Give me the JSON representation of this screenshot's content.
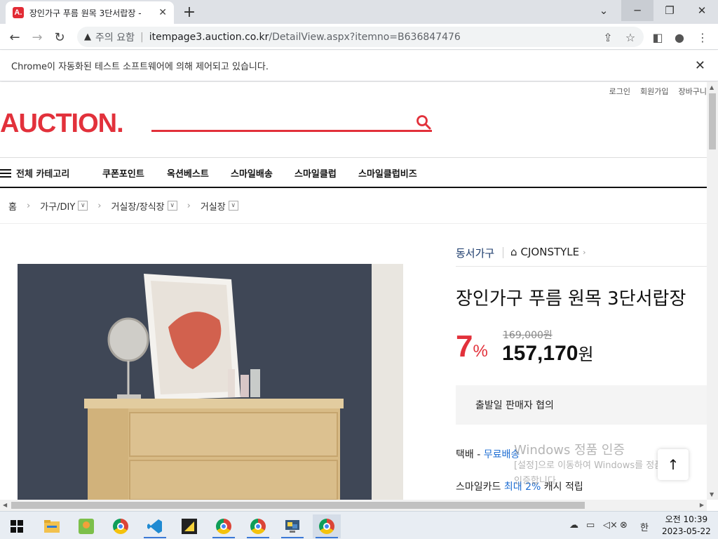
{
  "browser": {
    "tab_title": "장인가구 푸름 원목 3단서랍장 -",
    "tab_favicon": "A.",
    "security_label": "주의 요함",
    "url_host": "itempage3.auction.co.kr",
    "url_path": "/DetailView.aspx?itemno=B636847476",
    "infobar_text": "Chrome이 자동화된 테스트 소프트웨어에 의해 제어되고 있습니다."
  },
  "site": {
    "top_links": [
      "로그인",
      "회원가입",
      "장바구니"
    ],
    "logo": "AUCTION.",
    "all_category": "전체 카테고리",
    "menu": [
      "쿠폰포인트",
      "옥션베스트",
      "스마일배송",
      "스마일클럽",
      "스마일클럽비즈"
    ],
    "breadcrumb": [
      "홈",
      "가구/DIY",
      "거실장/장식장",
      "거실장"
    ]
  },
  "product": {
    "brand": "동서가구",
    "store": "CJONSTYLE",
    "title": "장인가구 푸름 원목 3단서랍장",
    "discount_number": "7",
    "discount_unit": "%",
    "original_price": "169,000원",
    "price_value": "157,170",
    "price_unit": "원",
    "ship_notice": "출발일 판매자 협의",
    "delivery_label": "택배 - ",
    "delivery_value": "무료배송",
    "card_label": "스마일카드 ",
    "card_value": "최대 2%",
    "card_suffix": " 캐시 적립"
  },
  "watermark": {
    "line1": "Windows 정품 인증",
    "line2": "[설정]으로 이동하여 Windows를 정품",
    "line3": "인증합니다."
  },
  "taskbar": {
    "time": "오전 10:39",
    "date": "2023-05-22",
    "ime": "한"
  },
  "colors": {
    "brand_red": "#e2313b",
    "link_blue": "#1e6ed3"
  }
}
